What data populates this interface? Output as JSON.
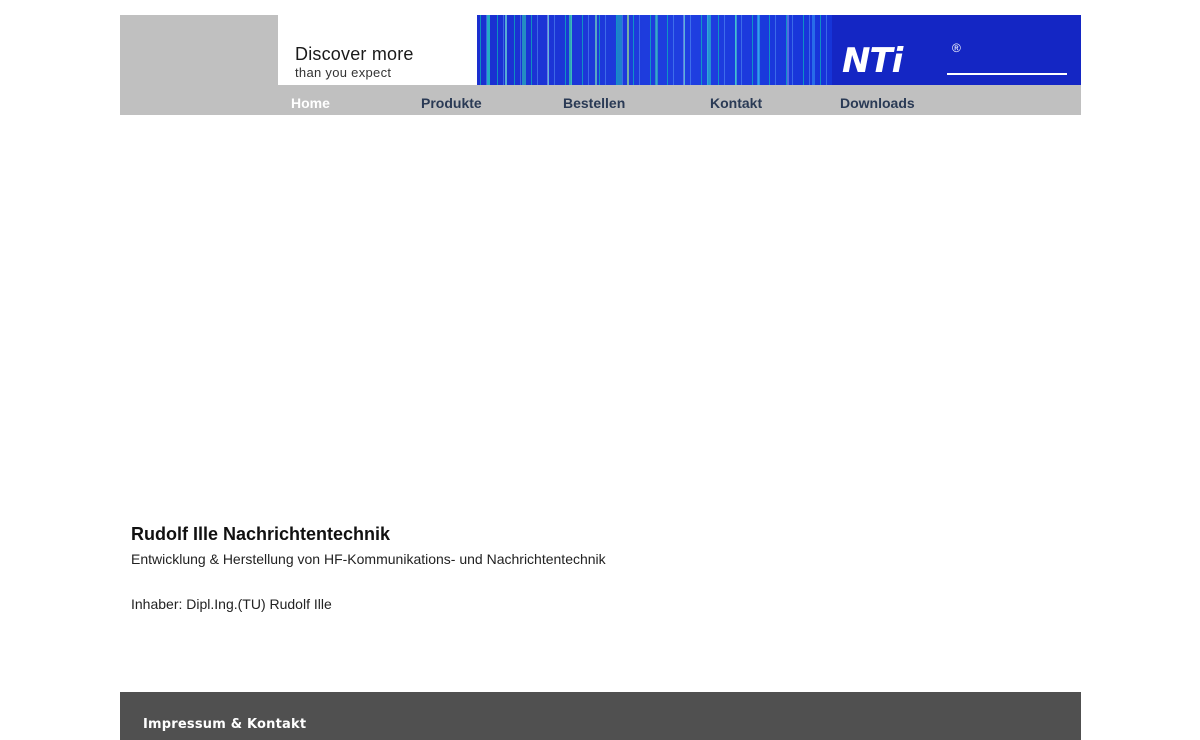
{
  "header": {
    "slogan_line1": "Discover more",
    "slogan_line2": "than you expect",
    "logo_text": "NTi",
    "logo_reg": "®"
  },
  "nav": {
    "items": [
      {
        "label": "Home",
        "active": true
      },
      {
        "label": "Produkte",
        "active": false
      },
      {
        "label": "Bestellen",
        "active": false
      },
      {
        "label": "Kontakt",
        "active": false
      },
      {
        "label": "Downloads",
        "active": false
      }
    ]
  },
  "main": {
    "company_name": "Rudolf Ille Nachrichtentechnik",
    "description": "Entwicklung & Herstellung von HF-Kommunikations- und Nachrichtentechnik",
    "owner": "Inhaber: Dipl.Ing.(TU) Rudolf Ille"
  },
  "footer": {
    "link_label": "Impressum & Kontakt"
  },
  "colors": {
    "header_gray": "#c0c0c0",
    "banner_blue": "#1f3fe0",
    "footer_gray": "#505050",
    "nav_text": "#2a3a55"
  }
}
